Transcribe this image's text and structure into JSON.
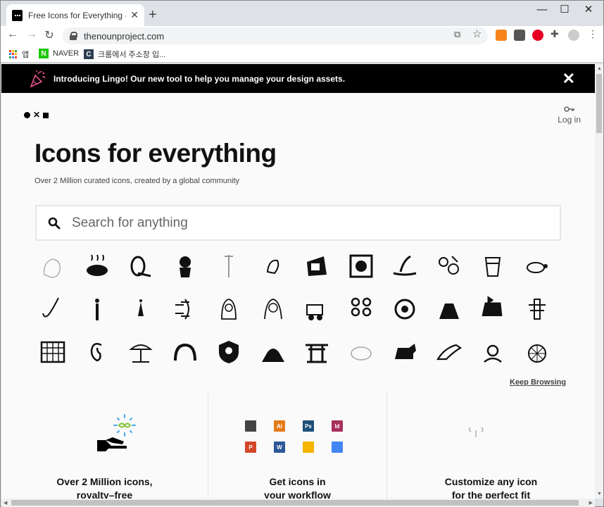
{
  "browser": {
    "tab_title": "Free Icons for Everything - Noun Project",
    "url": "thenounproject.com",
    "bookmarks": [
      "앱",
      "NAVER",
      "크롬에서 주소창 입..."
    ]
  },
  "banner": {
    "text": "Introducing Lingo! Our new tool to help you manage your design assets."
  },
  "header": {
    "login_label": "Log in"
  },
  "hero": {
    "title": "Icons for everything",
    "subtitle": "Over 2 Million curated icons, created by a global community"
  },
  "search": {
    "placeholder": "Search for anything"
  },
  "keep_browsing": "Keep Browsing",
  "features": [
    {
      "line1": "Over 2 Million icons,",
      "line2": "royalty–free"
    },
    {
      "line1": "Get icons in",
      "line2": "your workflow"
    },
    {
      "line1": "Customize any icon",
      "line2": "for the perfect fit"
    }
  ],
  "software_icons": [
    {
      "name": "apple-icon",
      "label": "",
      "color": "#444444"
    },
    {
      "name": "illustrator-icon",
      "label": "Ai",
      "color": "#e47b1a"
    },
    {
      "name": "photoshop-icon",
      "label": "Ps",
      "color": "#1d4f78"
    },
    {
      "name": "indesign-icon",
      "label": "Id",
      "color": "#a8305c"
    },
    {
      "name": "powerpoint-icon",
      "label": "P",
      "color": "#d24726"
    },
    {
      "name": "word-icon",
      "label": "W",
      "color": "#2b5797"
    },
    {
      "name": "google-slides-icon",
      "label": "",
      "color": "#f4b400"
    },
    {
      "name": "google-docs-icon",
      "label": "",
      "color": "#4285f4"
    }
  ],
  "icon_grid": [
    "woman-head-icon",
    "cooking-pot-icon",
    "cable-reel-icon",
    "woman-profile-icon",
    "tool-icon",
    "bird-icon",
    "geometric-box-icon",
    "radio-icon",
    "whale-tail-icon",
    "paint-palette-icon",
    "drink-cup-icon",
    "turtle-icon",
    "fishing-hook-icon",
    "man-standing-icon",
    "woman-standing-icon",
    "dna-helix-icon",
    "hijab-woman-icon",
    "nun-icon",
    "cart-icon",
    "tanghulu-icon",
    "dragon-icon",
    "cut-log-icon",
    "goat-icon",
    "tree-stump-icon",
    "calendar-icon",
    "ear-icon",
    "beach-umbrella-icon",
    "rainbow-icon",
    "user-shield-icon",
    "group-icon",
    "torii-gate-icon",
    "hippo-icon",
    "scottie-dog-icon",
    "lizard-icon",
    "speaking-person-icon",
    "disco-ball-icon"
  ],
  "colors": {
    "banner_bg": "#000000",
    "accent_blue": "#3fa9f5",
    "accent_green": "#8dc63f"
  }
}
